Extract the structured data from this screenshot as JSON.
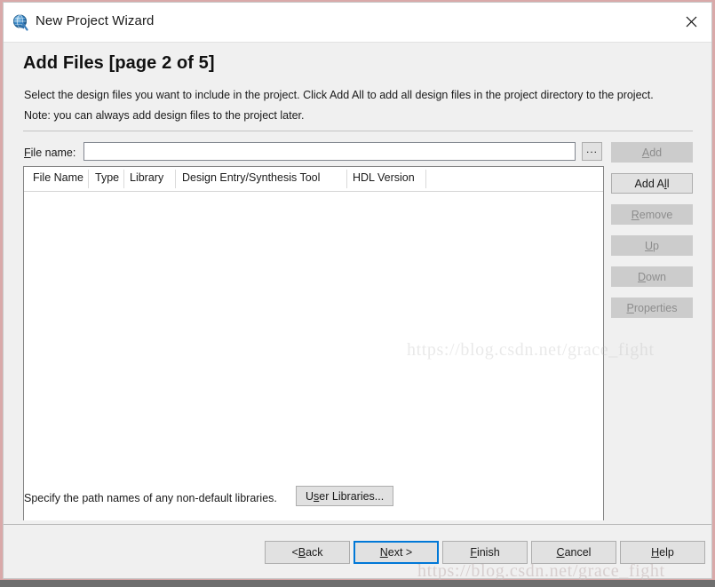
{
  "window": {
    "title": "New Project Wizard",
    "icon": "quartus-globe-icon",
    "close_label": "✕"
  },
  "page": {
    "title": "Add Files [page 2 of 5]",
    "description_line1": "Select the design files you want to include in the project. Click Add All to add all design files in the project directory to the project.",
    "description_line2": "Note: you can always add design files to the project later."
  },
  "file_name_row": {
    "label_before": "F",
    "label_mnemonic": "",
    "label": "File name:",
    "label_rest": "ile name:",
    "value": "",
    "placeholder": "",
    "browse_label": "..."
  },
  "file_list": {
    "columns": [
      {
        "label": "File Name"
      },
      {
        "label": "Type"
      },
      {
        "label": "Library"
      },
      {
        "label": "Design Entry/Synthesis Tool"
      },
      {
        "label": "HDL Version"
      }
    ],
    "rows": []
  },
  "side_buttons": [
    {
      "label": "Add",
      "pre": "",
      "mn": "A",
      "post": "dd",
      "enabled": false
    },
    {
      "label": "Add All",
      "pre": "Add A",
      "mn": "l",
      "post": "l",
      "enabled": true
    },
    {
      "label": "Remove",
      "pre": "",
      "mn": "R",
      "post": "emove",
      "enabled": false
    },
    {
      "label": "Up",
      "pre": "",
      "mn": "U",
      "post": "p",
      "enabled": false
    },
    {
      "label": "Down",
      "pre": "",
      "mn": "D",
      "post": "own",
      "enabled": false
    },
    {
      "label": "Properties",
      "pre": "",
      "mn": "P",
      "post": "roperties",
      "enabled": false
    }
  ],
  "libraries": {
    "text": "Specify the path names of any non-default libraries.",
    "button_pre": "U",
    "button_mn": "s",
    "button_post": "er Libraries..."
  },
  "nav_buttons": [
    {
      "pre": "< ",
      "mn": "B",
      "post": "ack",
      "label": "< Back",
      "focused": false
    },
    {
      "pre": "",
      "mn": "N",
      "post": "ext >",
      "label": "Next >",
      "focused": true
    },
    {
      "pre": "",
      "mn": "F",
      "post": "inish",
      "label": "Finish",
      "focused": false
    },
    {
      "pre": "",
      "mn": "C",
      "post": "ancel",
      "label": "Cancel",
      "focused": false
    },
    {
      "pre": "",
      "mn": "H",
      "post": "elp",
      "label": "Help",
      "focused": false
    }
  ],
  "watermarks": {
    "middle": "https://blog.csdn.net/grace_fight",
    "bottom": "https://blog.csdn.net/grace_fight"
  },
  "colors": {
    "accent_focus": "#0078d7",
    "dialog_bg": "#f0f0f0",
    "button_bg": "#e1e1e1",
    "button_disabled_bg": "#cccccc",
    "frame": "#d9a9a9"
  }
}
